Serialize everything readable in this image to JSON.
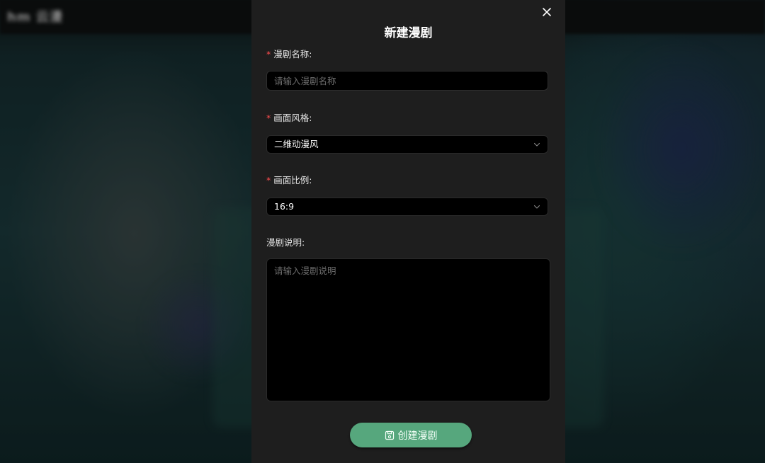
{
  "background": {
    "logo_text": "hm 云漫"
  },
  "modal": {
    "title": "新建漫剧",
    "close_icon": "close-icon",
    "fields": {
      "name": {
        "required_mark": "*",
        "label": "漫剧名称:",
        "value": "",
        "placeholder": "请输入漫剧名称"
      },
      "style": {
        "required_mark": "*",
        "label": "画面风格:",
        "selected": "二维动漫风"
      },
      "ratio": {
        "required_mark": "*",
        "label": "画面比例:",
        "selected": "16:9"
      },
      "description": {
        "label": "漫剧说明:",
        "value": "",
        "placeholder": "请输入漫剧说明"
      }
    },
    "submit": {
      "label": "创建漫剧",
      "icon": "save-icon",
      "color": "#56a77d"
    }
  }
}
